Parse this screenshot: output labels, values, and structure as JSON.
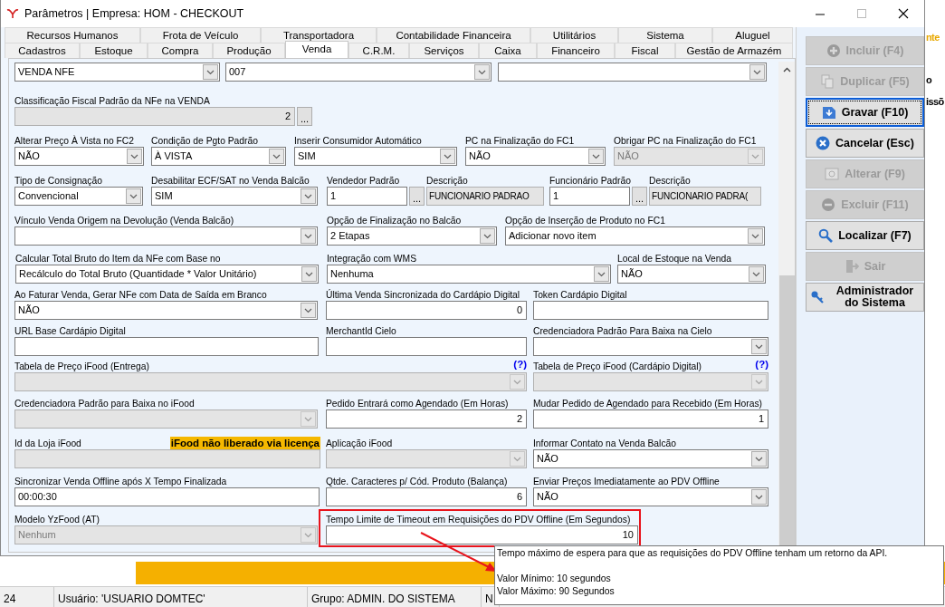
{
  "window": {
    "title": "Parâmetros | Empresa: HOM - CHECKOUT"
  },
  "tab_rows": [
    {
      "tabs": [
        {
          "label": "Recursos Humanos",
          "selected": false
        },
        {
          "label": "Frota de Veículo",
          "selected": false
        },
        {
          "label": "Transportadora",
          "selected": false
        },
        {
          "label": "Contabilidade Financeira",
          "selected": false
        },
        {
          "label": "Utilitários",
          "selected": false
        },
        {
          "label": "Sistema",
          "selected": false
        },
        {
          "label": "Aluguel",
          "selected": false
        }
      ]
    },
    {
      "tabs": [
        {
          "label": "Cadastros",
          "selected": false
        },
        {
          "label": "Estoque",
          "selected": false
        },
        {
          "label": "Compra",
          "selected": false
        },
        {
          "label": "Produção",
          "selected": false
        },
        {
          "label": "Venda",
          "selected": true
        },
        {
          "label": "C.R.M.",
          "selected": false
        },
        {
          "label": "Serviços",
          "selected": false
        },
        {
          "label": "Caixa",
          "selected": false
        },
        {
          "label": "Financeiro",
          "selected": false
        },
        {
          "label": "Fiscal",
          "selected": false
        },
        {
          "label": "Gestão de Armazém",
          "selected": false
        }
      ]
    }
  ],
  "form": {
    "rows": [
      {
        "fields": [
          {
            "kind": "select",
            "value": "VENDA NFE",
            "disabled": false
          },
          {
            "kind": "select",
            "value": "007",
            "disabled": false
          },
          {
            "kind": "select",
            "disabled": false
          }
        ]
      },
      {
        "fields": [
          {
            "label": "Classificação Fiscal Padrão da NFe na VENDA",
            "kind": "lookup_number",
            "value": "2",
            "button": "...",
            "disabled": true
          }
        ]
      },
      {
        "fields": [
          {
            "label": "Alterar Preço À Vista no FC2",
            "kind": "select",
            "value": "NÃO",
            "disabled": false
          },
          {
            "label": "Condição de Pgto Padrão",
            "kind": "select",
            "value": "À VISTA",
            "disabled": false
          },
          {
            "label": "Inserir Consumidor Automático",
            "kind": "select",
            "value": "SIM",
            "disabled": false
          },
          {
            "label": "PC na Finalização do FC1",
            "kind": "select",
            "value": "NÃO",
            "disabled": false
          },
          {
            "label": "Obrigar PC na Finalização do FC1",
            "kind": "select",
            "value": "NÃO",
            "disabled": true
          }
        ]
      },
      {
        "fields": [
          {
            "label": "Tipo de Consignação",
            "kind": "select",
            "value": "Convencional",
            "disabled": false
          },
          {
            "label": "Desabilitar ECF/SAT no Venda Balcão",
            "kind": "select",
            "value": "SIM",
            "disabled": false
          },
          {
            "label": "Vendedor Padrão",
            "kind": "lookup",
            "value": "1",
            "button": "...",
            "disabled": false
          },
          {
            "label": "Descrição",
            "kind": "text",
            "value": "FUNCIONARIO PADRAO",
            "disabled": true
          },
          {
            "label": "Funcionário Padrão",
            "kind": "lookup",
            "value": "1",
            "button": "...",
            "disabled": false
          },
          {
            "label": "Descrição",
            "kind": "text",
            "value": "FUNCIONARIO PADRA(",
            "disabled": true
          }
        ]
      },
      {
        "fields": [
          {
            "label": "Vínculo Venda Origem na Devolução (Venda Balcão)",
            "kind": "select",
            "disabled": false
          },
          {
            "label": "Opção de Finalização no Balcão",
            "kind": "select",
            "value": "2 Etapas",
            "disabled": false
          },
          {
            "label": "Opção de Inserção de Produto no FC1",
            "kind": "select",
            "value": "Adicionar novo item",
            "disabled": false
          }
        ]
      },
      {
        "fields": [
          {
            "label": "Calcular Total Bruto do Item da NFe com Base no",
            "kind": "select",
            "value": "Recálculo do Total Bruto (Quantidade * Valor Unitário)",
            "disabled": false
          },
          {
            "label": "Integração com WMS",
            "kind": "select",
            "value": "Nenhuma",
            "disabled": false
          },
          {
            "label": "Local de Estoque na Venda",
            "kind": "select",
            "value": "NÃO",
            "disabled": false
          }
        ]
      },
      {
        "fields": [
          {
            "label": "Ao Faturar Venda, Gerar NFe com Data de Saída em Branco",
            "kind": "select",
            "value": "NÃO",
            "disabled": false
          },
          {
            "label": "Última Venda Sincronizada do Cardápio Digital",
            "kind": "number",
            "value": "0",
            "disabled": false
          },
          {
            "label": "Token Cardápio Digital",
            "kind": "text",
            "disabled": false
          }
        ]
      },
      {
        "fields": [
          {
            "label": "URL Base Cardápio Digital",
            "kind": "text",
            "disabled": false
          },
          {
            "label": "MerchantId Cielo",
            "kind": "text",
            "disabled": false
          },
          {
            "label": "Credenciadora Padrão Para Baixa na Cielo",
            "kind": "select",
            "disabled": false
          }
        ]
      },
      {
        "fields": [
          {
            "label": "Tabela de Preço iFood (Entrega)",
            "help": "(?)",
            "kind": "select",
            "disabled": true
          },
          {
            "label": "Tabela de Preço iFood (Cardápio Digital)",
            "help": "(?)",
            "kind": "select",
            "disabled": true
          }
        ]
      },
      {
        "fields": [
          {
            "label": "Credenciadora Padrão para Baixa no iFood",
            "kind": "select",
            "disabled": true
          },
          {
            "label": "Pedido Entrará como Agendado (Em Horas)",
            "kind": "number",
            "value": "2",
            "disabled": false
          },
          {
            "label": "Mudar Pedido de Agendado para Recebido (Em Horas)",
            "kind": "number",
            "value": "1",
            "disabled": false
          }
        ]
      },
      {
        "fields": [
          {
            "label": "Id da Loja iFood",
            "note": "iFood não liberado via licença",
            "kind": "text",
            "disabled": true
          },
          {
            "label": "Aplicação iFood",
            "kind": "select",
            "disabled": true
          },
          {
            "label": "Informar Contato na Venda Balcão",
            "kind": "select",
            "value": "NÃO",
            "disabled": false
          }
        ]
      },
      {
        "fields": [
          {
            "label": "Sincronizar Venda Offline após X Tempo Finalizada",
            "kind": "text",
            "value": "00:00:30",
            "disabled": false
          },
          {
            "label": "Qtde. Caracteres p/ Cód. Produto (Balança)",
            "kind": "number",
            "value": "6",
            "disabled": false
          },
          {
            "label": "Enviar Preços Imediatamente ao PDV Offline",
            "kind": "select",
            "value": "NÃO",
            "disabled": false
          }
        ]
      },
      {
        "fields": [
          {
            "label": "Modelo YzFood (AT)",
            "kind": "select",
            "value": "Nenhum",
            "disabled": true
          },
          {
            "label": "Tempo Limite de Timeout em Requisições do PDV Offline (Em Segundos)",
            "kind": "number",
            "value": "10",
            "disabled": false,
            "highlighted": true
          }
        ]
      }
    ]
  },
  "buttons": [
    {
      "label": "Incluir (F4)",
      "kind": "plus",
      "disabled": true,
      "focused": false
    },
    {
      "label": "Duplicar (F5)",
      "kind": "copy",
      "disabled": true,
      "focused": false
    },
    {
      "label": "Gravar (F10)",
      "kind": "save",
      "disabled": false,
      "focused": true
    },
    {
      "label": "Cancelar (Esc)",
      "kind": "cancel",
      "disabled": false,
      "focused": false
    },
    {
      "label": "Alterar (F9)",
      "kind": "edit",
      "disabled": true,
      "focused": false
    },
    {
      "label": "Excluir (F11)",
      "kind": "minus",
      "disabled": true,
      "focused": false
    },
    {
      "label": "Localizar (F7)",
      "kind": "search",
      "disabled": false,
      "focused": false
    },
    {
      "label": "Sair",
      "kind": "exit",
      "disabled": true,
      "focused": false
    },
    {
      "label": "Administrador do Sistema",
      "kind": "key",
      "disabled": false,
      "focused": false
    }
  ],
  "tooltip": {
    "lines": [
      "Tempo máximo de espera para que as requisições do PDV Offline tenham um retorno da API.",
      "Valor Mínimo:  10 segundos",
      "Valor Máximo: 90 Segundos"
    ]
  },
  "background_text": [
    "nte",
    "o",
    "issõ"
  ],
  "status_bar": {
    "items": [
      "24",
      "Usuário: 'USUARIO DOMTEC'",
      "Grupo: ADMIN. DO SISTEMA",
      "N"
    ]
  }
}
